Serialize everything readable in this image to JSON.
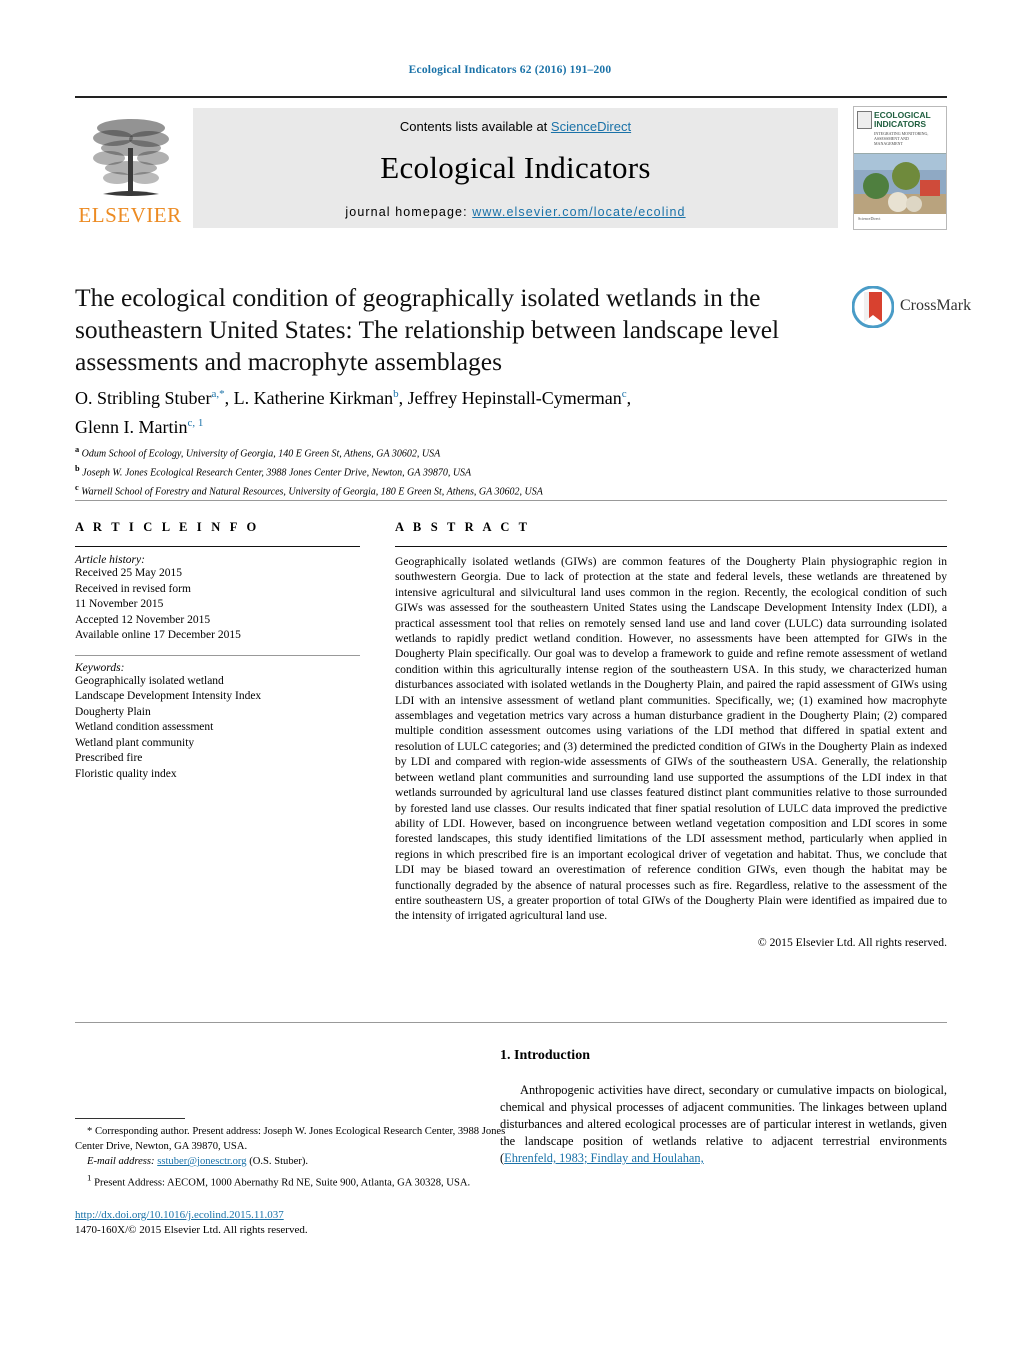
{
  "running_head": "Ecological Indicators 62 (2016) 191–200",
  "masthead": {
    "contents_prefix": "Contents lists available at ",
    "contents_link": "ScienceDirect",
    "journal_title": "Ecological Indicators",
    "homepage_prefix": "journal homepage: ",
    "homepage_url": "www.elsevier.com/locate/ecolind",
    "publisher": "ELSEVIER",
    "cover": {
      "title_line1": "ECOLOGICAL",
      "title_line2": "INDICATORS",
      "subtitle": "INTEGRATING MONITORING, ASSESSMENT AND MANAGEMENT"
    }
  },
  "article": {
    "title": "The ecological condition of geographically isolated wetlands in the southeastern United States: The relationship between landscape level assessments and macrophyte assemblages",
    "crossmark_label": "CrossMark",
    "authors": [
      {
        "name": "O. Stribling Stuber",
        "marks": "a,*"
      },
      {
        "name": "L. Katherine Kirkman",
        "marks": "b"
      },
      {
        "name": "Jeffrey Hepinstall-Cymerman",
        "marks": "c"
      },
      {
        "name": "Glenn I. Martin",
        "marks": "c, 1"
      }
    ],
    "affiliations": [
      {
        "mark": "a",
        "text": "Odum School of Ecology, University of Georgia, 140 E Green St, Athens, GA 30602, USA"
      },
      {
        "mark": "b",
        "text": "Joseph W. Jones Ecological Research Center, 3988 Jones Center Drive, Newton, GA 39870, USA"
      },
      {
        "mark": "c",
        "text": "Warnell School of Forestry and Natural Resources, University of Georgia, 180 E Green St, Athens, GA 30602, USA"
      }
    ]
  },
  "article_info": {
    "heading": "A R T I C L E   I N F O",
    "history_label": "Article history:",
    "history": [
      "Received 25 May 2015",
      "Received in revised form",
      "11 November 2015",
      "Accepted 12 November 2015",
      "Available online 17 December 2015"
    ],
    "keywords_label": "Keywords:",
    "keywords": [
      "Geographically isolated wetland",
      "Landscape Development Intensity Index",
      "Dougherty Plain",
      "Wetland condition assessment",
      "Wetland plant community",
      "Prescribed fire",
      "Floristic quality index"
    ]
  },
  "abstract": {
    "heading": "A B S T R A C T",
    "text": "Geographically isolated wetlands (GIWs) are common features of the Dougherty Plain physiographic region in southwestern Georgia. Due to lack of protection at the state and federal levels, these wetlands are threatened by intensive agricultural and silvicultural land uses common in the region. Recently, the ecological condition of such GIWs was assessed for the southeastern United States using the Landscape Development Intensity Index (LDI), a practical assessment tool that relies on remotely sensed land use and land cover (LULC) data surrounding isolated wetlands to rapidly predict wetland condition. However, no assessments have been attempted for GIWs in the Dougherty Plain specifically. Our goal was to develop a framework to guide and refine remote assessment of wetland condition within this agriculturally intense region of the southeastern USA. In this study, we characterized human disturbances associated with isolated wetlands in the Dougherty Plain, and paired the rapid assessment of GIWs using LDI with an intensive assessment of wetland plant communities. Specifically, we; (1) examined how macrophyte assemblages and vegetation metrics vary across a human disturbance gradient in the Dougherty Plain; (2) compared multiple condition assessment outcomes using variations of the LDI method that differed in spatial extent and resolution of LULC categories; and (3) determined the predicted condition of GIWs in the Dougherty Plain as indexed by LDI and compared with region-wide assessments of GIWs of the southeastern USA. Generally, the relationship between wetland plant communities and surrounding land use supported the assumptions of the LDI index in that wetlands surrounded by agricultural land use classes featured distinct plant communities relative to those surrounded by forested land use classes. Our results indicated that finer spatial resolution of LULC data improved the predictive ability of LDI. However, based on incongruence between wetland vegetation composition and LDI scores in some forested landscapes, this study identified limitations of the LDI assessment method, particularly when applied in regions in which prescribed fire is an important ecological driver of vegetation and habitat. Thus, we conclude that LDI may be biased toward an overestimation of reference condition GIWs, even though the habitat may be functionally degraded by the absence of natural processes such as fire. Regardless, relative to the assessment of the entire southeastern US, a greater proportion of total GIWs of the Dougherty Plain were identified as impaired due to the intensity of irrigated agricultural land use.",
    "copyright": "© 2015 Elsevier Ltd. All rights reserved."
  },
  "introduction": {
    "heading": "1.  Introduction",
    "paragraph_start": "Anthropogenic activities have direct, secondary or cumulative impacts on biological, chemical and physical processes of adjacent communities. The linkages between upland disturbances and altered ecological processes are of particular interest in wetlands, given the landscape position of wetlands relative to adjacent terrestrial environments (",
    "citation": "Ehrenfeld, 1983; Findlay and Houlahan,"
  },
  "footnotes": {
    "corresponding_mark": "*",
    "corresponding": "Corresponding author. Present address: Joseph W. Jones Ecological Research Center, 3988 Jones Center Drive, Newton, GA 39870, USA.",
    "email_label": "E-mail address:",
    "email": "sstuber@jonesctr.org",
    "email_owner": "(O.S. Stuber).",
    "present_mark": "1",
    "present_address": "Present Address: AECOM, 1000 Abernathy Rd NE, Suite 900, Atlanta, GA 30328, USA."
  },
  "footer": {
    "doi": "http://dx.doi.org/10.1016/j.ecolind.2015.11.037",
    "issn_copyright": "1470-160X/© 2015 Elsevier Ltd. All rights reserved."
  },
  "colors": {
    "link_blue": "#1a72a8",
    "elsevier_orange": "#ec8b23",
    "masthead_gray": "#e9e9e9"
  }
}
